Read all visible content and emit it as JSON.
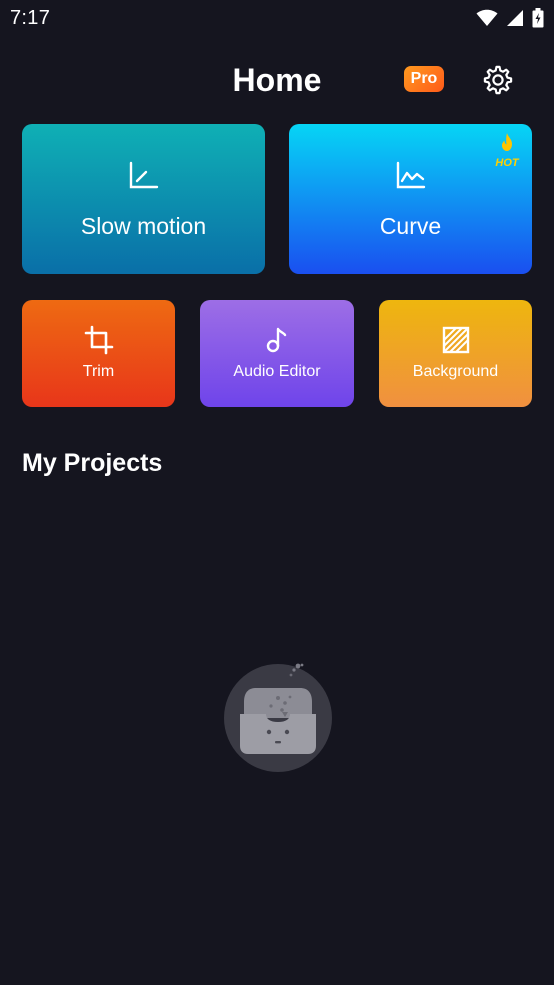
{
  "status_bar": {
    "time": "7:17",
    "icons": [
      "wifi-icon",
      "signal-icon",
      "battery-icon"
    ]
  },
  "header": {
    "title": "Home",
    "pro_label": "Pro",
    "settings_icon": "gear-icon"
  },
  "features": {
    "slow_motion": {
      "label": "Slow motion",
      "icon": "slow-motion-graph-icon"
    },
    "curve": {
      "label": "Curve",
      "icon": "curve-graph-icon",
      "badge": "HOT"
    },
    "trim": {
      "label": "Trim",
      "icon": "crop-icon"
    },
    "audio_editor": {
      "label": "Audio Editor",
      "icon": "music-note-icon"
    },
    "background": {
      "label": "Background",
      "icon": "hatched-square-icon"
    }
  },
  "projects": {
    "title": "My Projects",
    "empty_icon": "empty-inbox-icon"
  },
  "colors": {
    "background": "#15151f",
    "slow_motion": [
      "#0fb0b5",
      "#0a6fa8"
    ],
    "curve": [
      "#06d5f5",
      "#1a4ff0"
    ],
    "trim": [
      "#ee6a12",
      "#e8361a"
    ],
    "audio_editor": [
      "#9d6ee6",
      "#6f44ea"
    ],
    "background_card": [
      "#eeb60e",
      "#f09040"
    ],
    "pro_badge": "#ff7a1f",
    "hot": "#ffd000"
  }
}
